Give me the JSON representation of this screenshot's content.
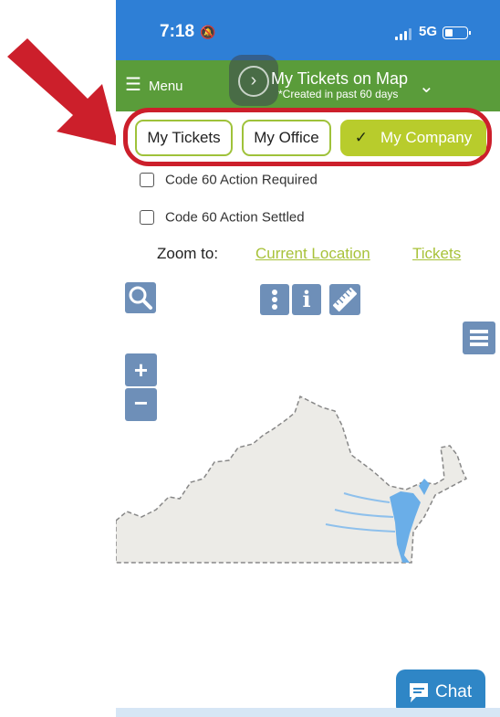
{
  "status_bar": {
    "time": "7:18",
    "network": "5G"
  },
  "app_bar": {
    "menu_label": "Menu",
    "title": "My Tickets on Map",
    "subtitle": "*Created in past 60 days"
  },
  "tabs": [
    {
      "label": "My Tickets",
      "selected": false
    },
    {
      "label": "My Office",
      "selected": false
    },
    {
      "label": "My Company",
      "selected": true
    }
  ],
  "filters": [
    {
      "label": "Code 60 Action Required",
      "checked": false
    },
    {
      "label": "Code 60 Action Settled",
      "checked": false
    }
  ],
  "zoom": {
    "label": "Zoom to:",
    "links": [
      "Current Location",
      "Tickets"
    ]
  },
  "map_controls": {
    "zoom_in": "+",
    "zoom_out": "−",
    "info": "i"
  },
  "chat": {
    "label": "Chat"
  },
  "colors": {
    "status_bar": "#2e7fd6",
    "app_bar": "#5a9c3a",
    "tab_border": "#9fc23a",
    "tab_selected": "#b8cc2c",
    "highlight": "#cc1f2b",
    "map_button": "#6e8fb8",
    "chat_button": "#2f86c6"
  }
}
